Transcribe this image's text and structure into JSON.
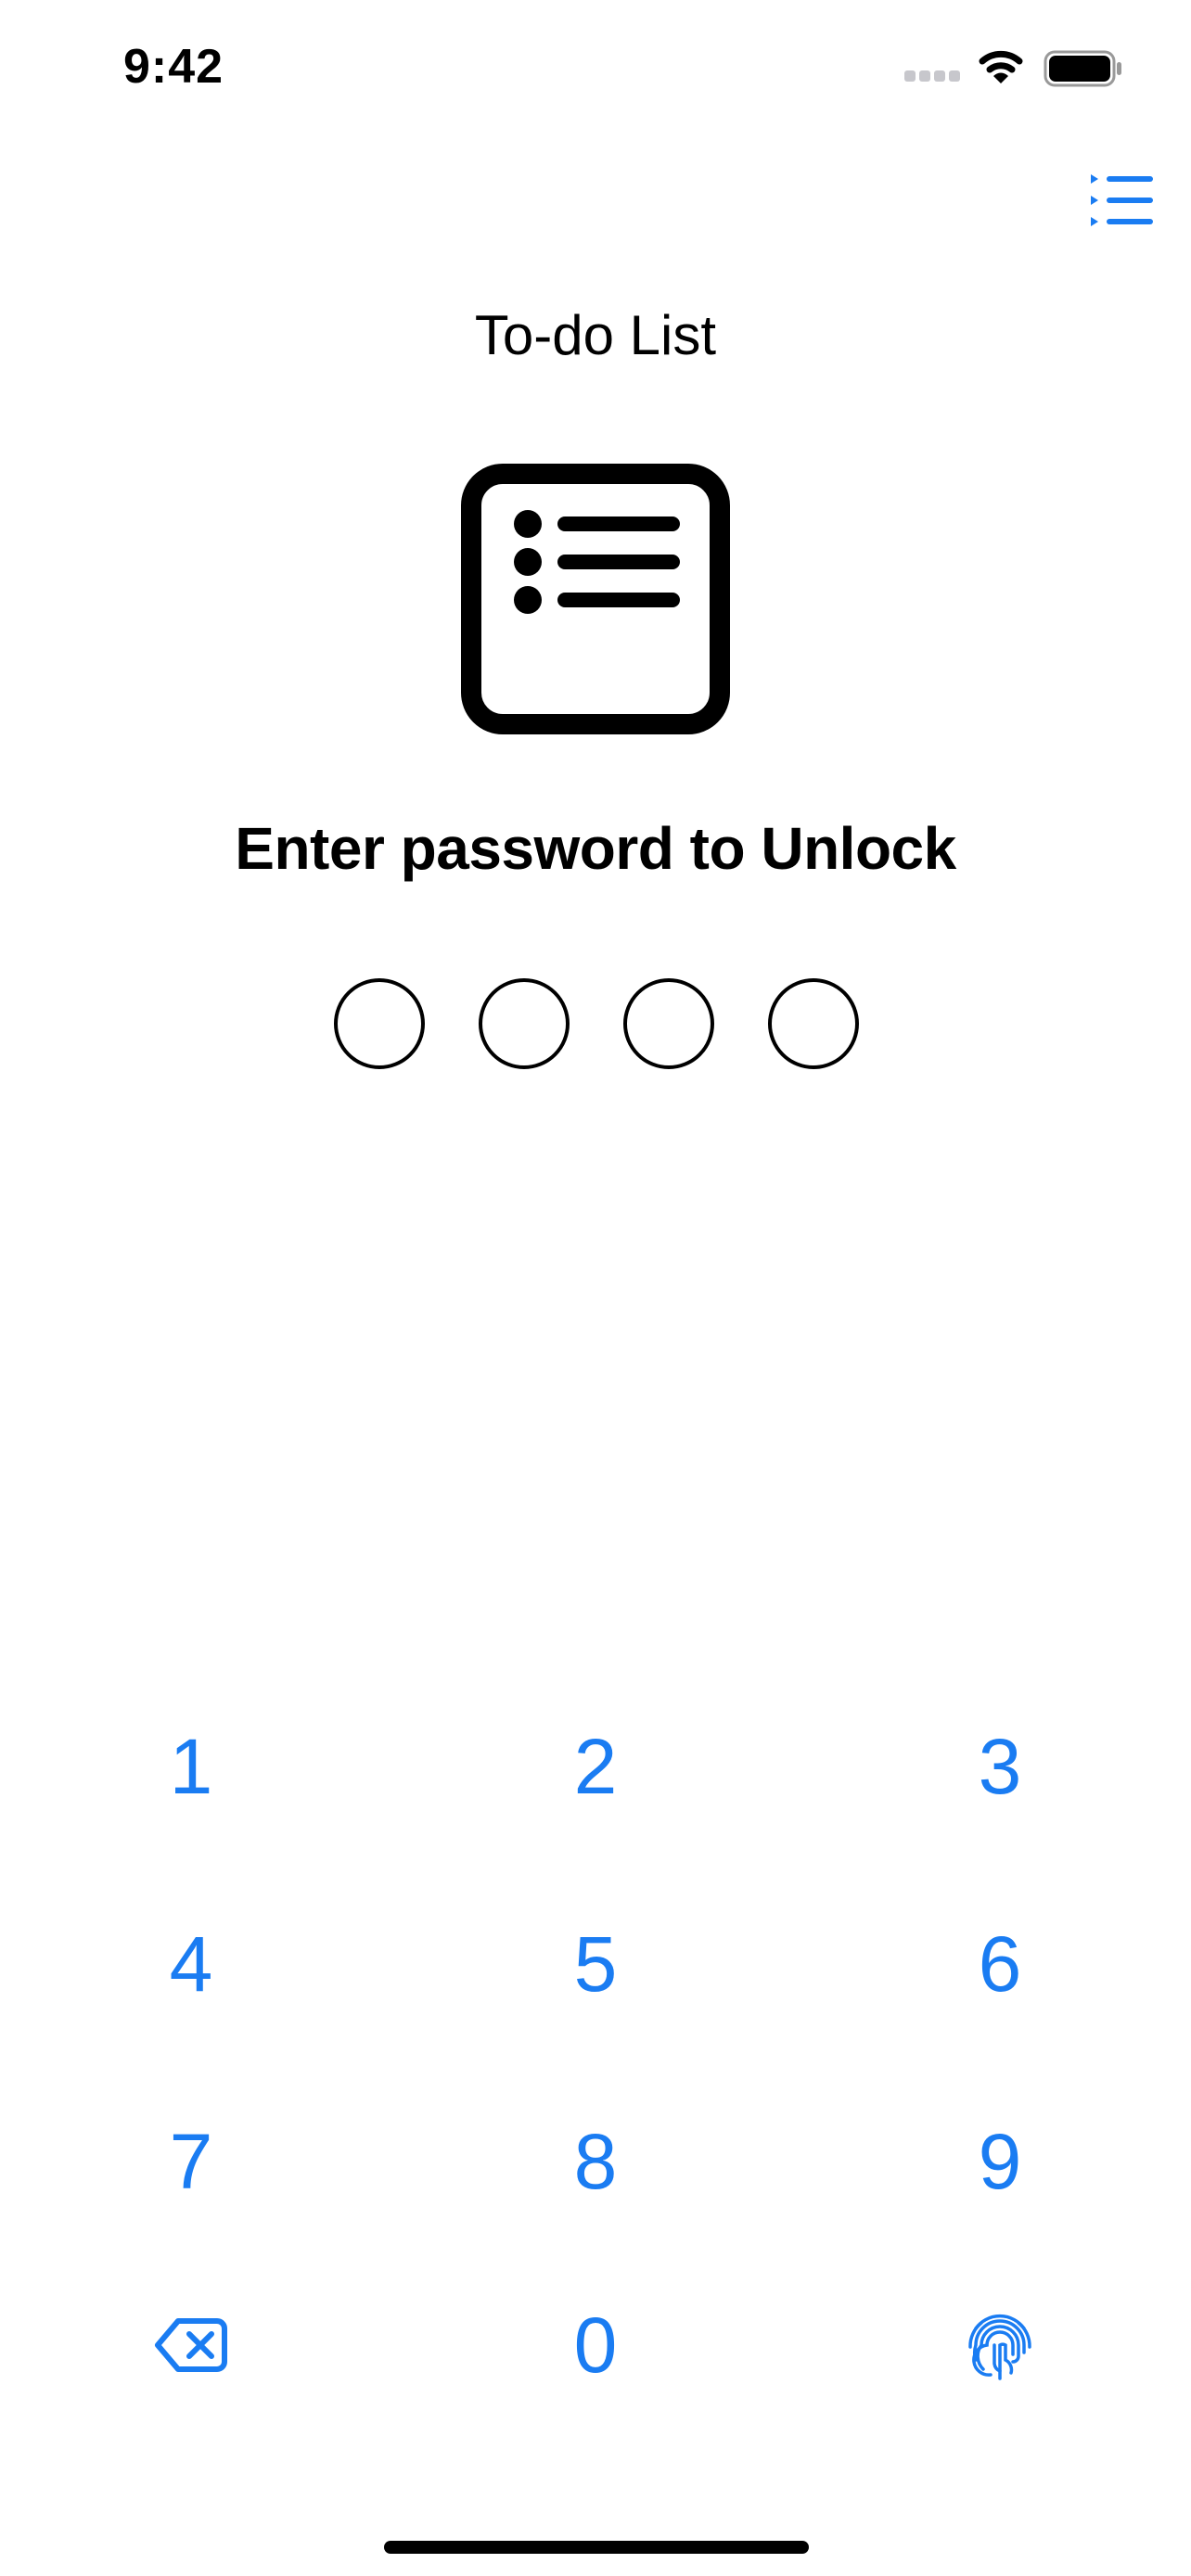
{
  "status_bar": {
    "time": "9:42",
    "signal_icon": "cellular-signal-icon",
    "wifi_icon": "wifi-icon",
    "battery_icon": "battery-icon",
    "battery_level": 1.0
  },
  "header": {
    "menu_icon": "list-bullet-icon"
  },
  "app": {
    "title": "To-do List",
    "icon": "list-bullet-rectangle-icon"
  },
  "lock": {
    "prompt": "Enter password to Unlock",
    "passcode_length": 4,
    "digits_entered": 0
  },
  "keypad": {
    "keys": [
      "1",
      "2",
      "3",
      "4",
      "5",
      "6",
      "7",
      "8",
      "9",
      "0"
    ],
    "delete_icon": "delete-backward-icon",
    "biometric_icon": "fingerprint-icon"
  },
  "colors": {
    "accent": "#1a7cf2",
    "text": "#000000",
    "background": "#ffffff"
  }
}
